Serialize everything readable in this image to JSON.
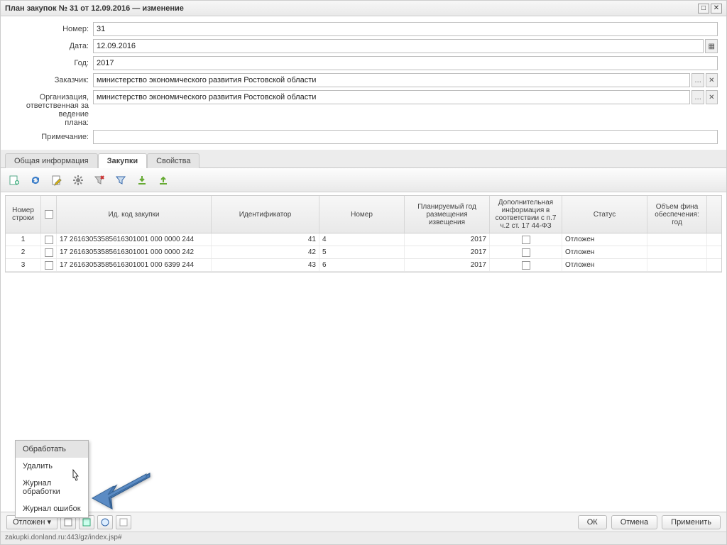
{
  "titlebar": {
    "title": "План закупок № 31 от 12.09.2016 — изменение"
  },
  "form": {
    "num_label": "Номер:",
    "num_value": "31",
    "date_label": "Дата:",
    "date_value": "12.09.2016",
    "year_label": "Год:",
    "year_value": "2017",
    "customer_label": "Заказчик:",
    "customer_value": "министерство экономического развития Ростовской области",
    "org_label": "Организация,\nответственная за ведение\nплана:",
    "org_value": "министерство экономического развития Ростовской области",
    "note_label": "Примечание:",
    "note_value": ""
  },
  "tabs": {
    "general": "Общая информация",
    "purchases": "Закупки",
    "props": "Свойства"
  },
  "toolbar_icons": [
    "add",
    "refresh",
    "edit",
    "gear",
    "filter-clear",
    "filter",
    "export-down",
    "export-up"
  ],
  "columns": {
    "rownum": "Номер строки",
    "chk": "",
    "idcode": "Ид. код закупки",
    "ident": "Идентификатор",
    "nomer": "Номер",
    "year": "Планируемый год размещения извещения",
    "dop": "Дополнительная информация в соответствии с п.7 ч.2 ст. 17 44-ФЗ",
    "status": "Статус",
    "amount": "Объем фина обеспечения: год"
  },
  "rows": [
    {
      "rownum": "1",
      "idcode": "17 26163053585616301001 000 0000 244",
      "ident": "41",
      "nomer": "4",
      "year": "2017",
      "status": "Отложен"
    },
    {
      "rownum": "2",
      "idcode": "17 26163053585616301001 000 0000 242",
      "ident": "42",
      "nomer": "5",
      "year": "2017",
      "status": "Отложен"
    },
    {
      "rownum": "3",
      "idcode": "17 26163053585616301001 000 6399 244",
      "ident": "43",
      "nomer": "6",
      "year": "2017",
      "status": "Отложен"
    }
  ],
  "popup": {
    "process": "Обработать",
    "delete": "Удалить",
    "journal_proc": "Журнал обработки",
    "journal_err": "Журнал ошибок"
  },
  "bottom": {
    "state_btn": "Отложен ▾",
    "ok": "ОК",
    "cancel": "Отмена",
    "apply": "Применить"
  },
  "statusbar": {
    "text": "zakupki.donland.ru:443/gz/index.jsp#"
  }
}
